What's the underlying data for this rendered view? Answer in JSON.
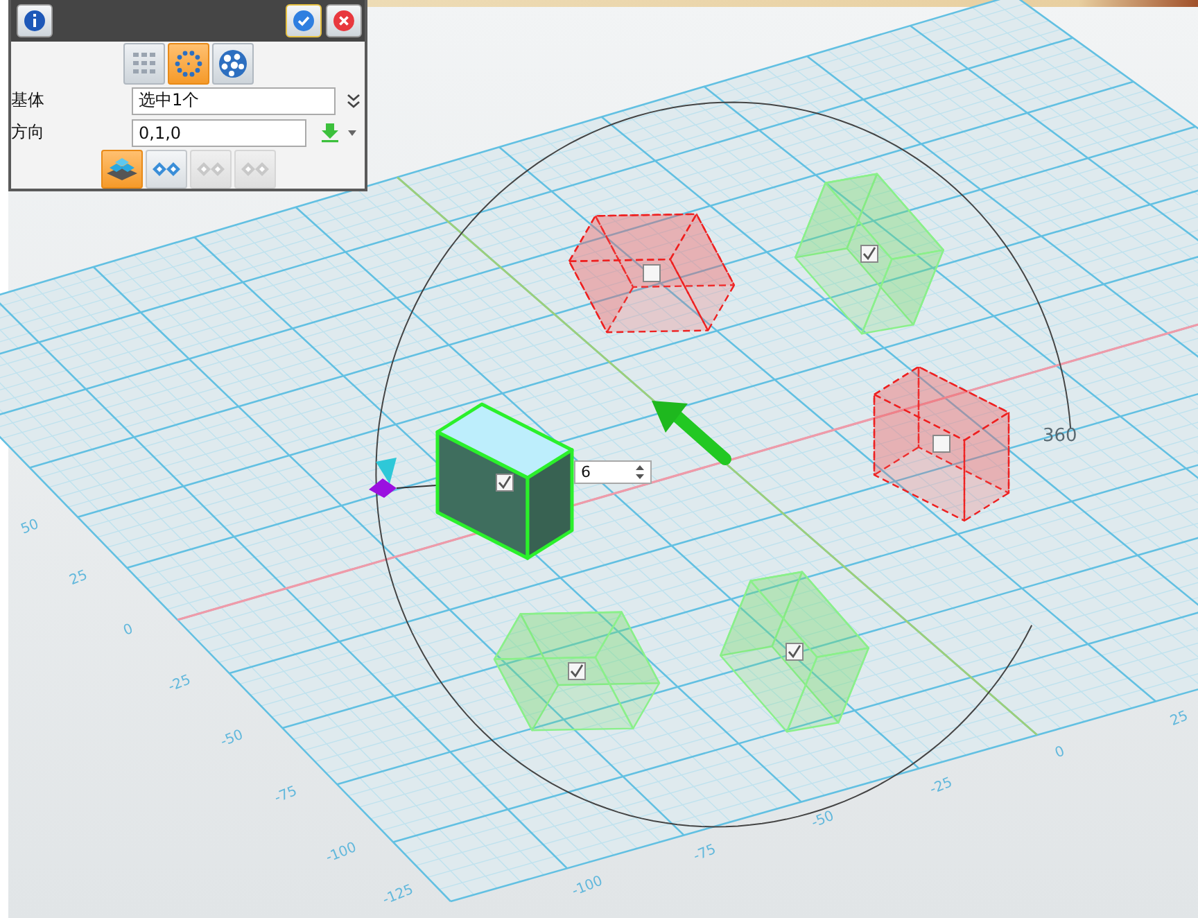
{
  "panel": {
    "mode_buttons": [
      {
        "selected": false
      },
      {
        "selected": true
      },
      {
        "selected": false
      }
    ],
    "fields": [
      {
        "label": "基体",
        "value": "选中1个"
      },
      {
        "label": "方向",
        "value": "0,1,0"
      }
    ],
    "option_buttons": [
      {
        "selected": true,
        "disabled": false
      },
      {
        "selected": false,
        "disabled": false
      },
      {
        "selected": false,
        "disabled": true
      },
      {
        "selected": false,
        "disabled": true
      }
    ]
  },
  "viewport": {
    "left_axis_labels": [
      "50",
      "25",
      "0",
      "-25",
      "-50",
      "-75",
      "-100",
      "-125"
    ],
    "bottom_axis_labels": [
      "-100",
      "-75",
      "-50",
      "-25",
      "0",
      "25"
    ],
    "angle_label": "360",
    "count_field": {
      "value": "6"
    },
    "main_cube": {
      "checked": true
    },
    "copies": [
      {
        "checked": false
      },
      {
        "checked": true
      },
      {
        "checked": false
      },
      {
        "checked": true
      },
      {
        "checked": true
      }
    ]
  }
}
